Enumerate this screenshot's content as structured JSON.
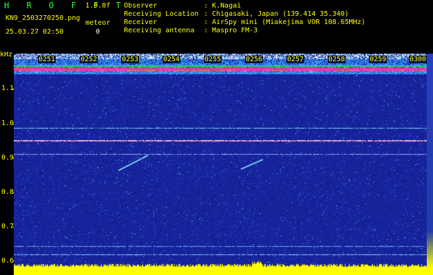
{
  "header": {
    "title": "H R O F F T",
    "version": "1.0.0f",
    "filename": "KN9_2503270250.png",
    "meteor_label": "meteor",
    "meteor_count": "0",
    "timestamp": "25.03.27 02:50"
  },
  "info": [
    {
      "label": "Observer",
      "value": "K.Nagai"
    },
    {
      "label": "Receiving Location",
      "value": "Chigasaki, Japan (139.414 35.340)"
    },
    {
      "label": "Receiver",
      "value": "AirSpy mini (Miakejima VOR 108.65MHz)"
    },
    {
      "label": "Receiving antenna",
      "value": "Maspro FM-3"
    }
  ],
  "axis": {
    "unit": "kHz",
    "y_labels": [
      "1.1",
      "1.0",
      "0.9",
      "0.8",
      "0.7",
      "0.6"
    ],
    "time_labels": [
      "0251",
      "0252",
      "0253",
      "0254",
      "0255",
      "0256",
      "0257",
      "0258",
      "0259",
      "0300"
    ]
  },
  "colors": {
    "text": "#ffff00",
    "title": "#33ff33",
    "background": "#000000",
    "spectrum_base": "#1a2a9a",
    "signal_line": "#ff3399",
    "baseline": "#ffff00"
  }
}
